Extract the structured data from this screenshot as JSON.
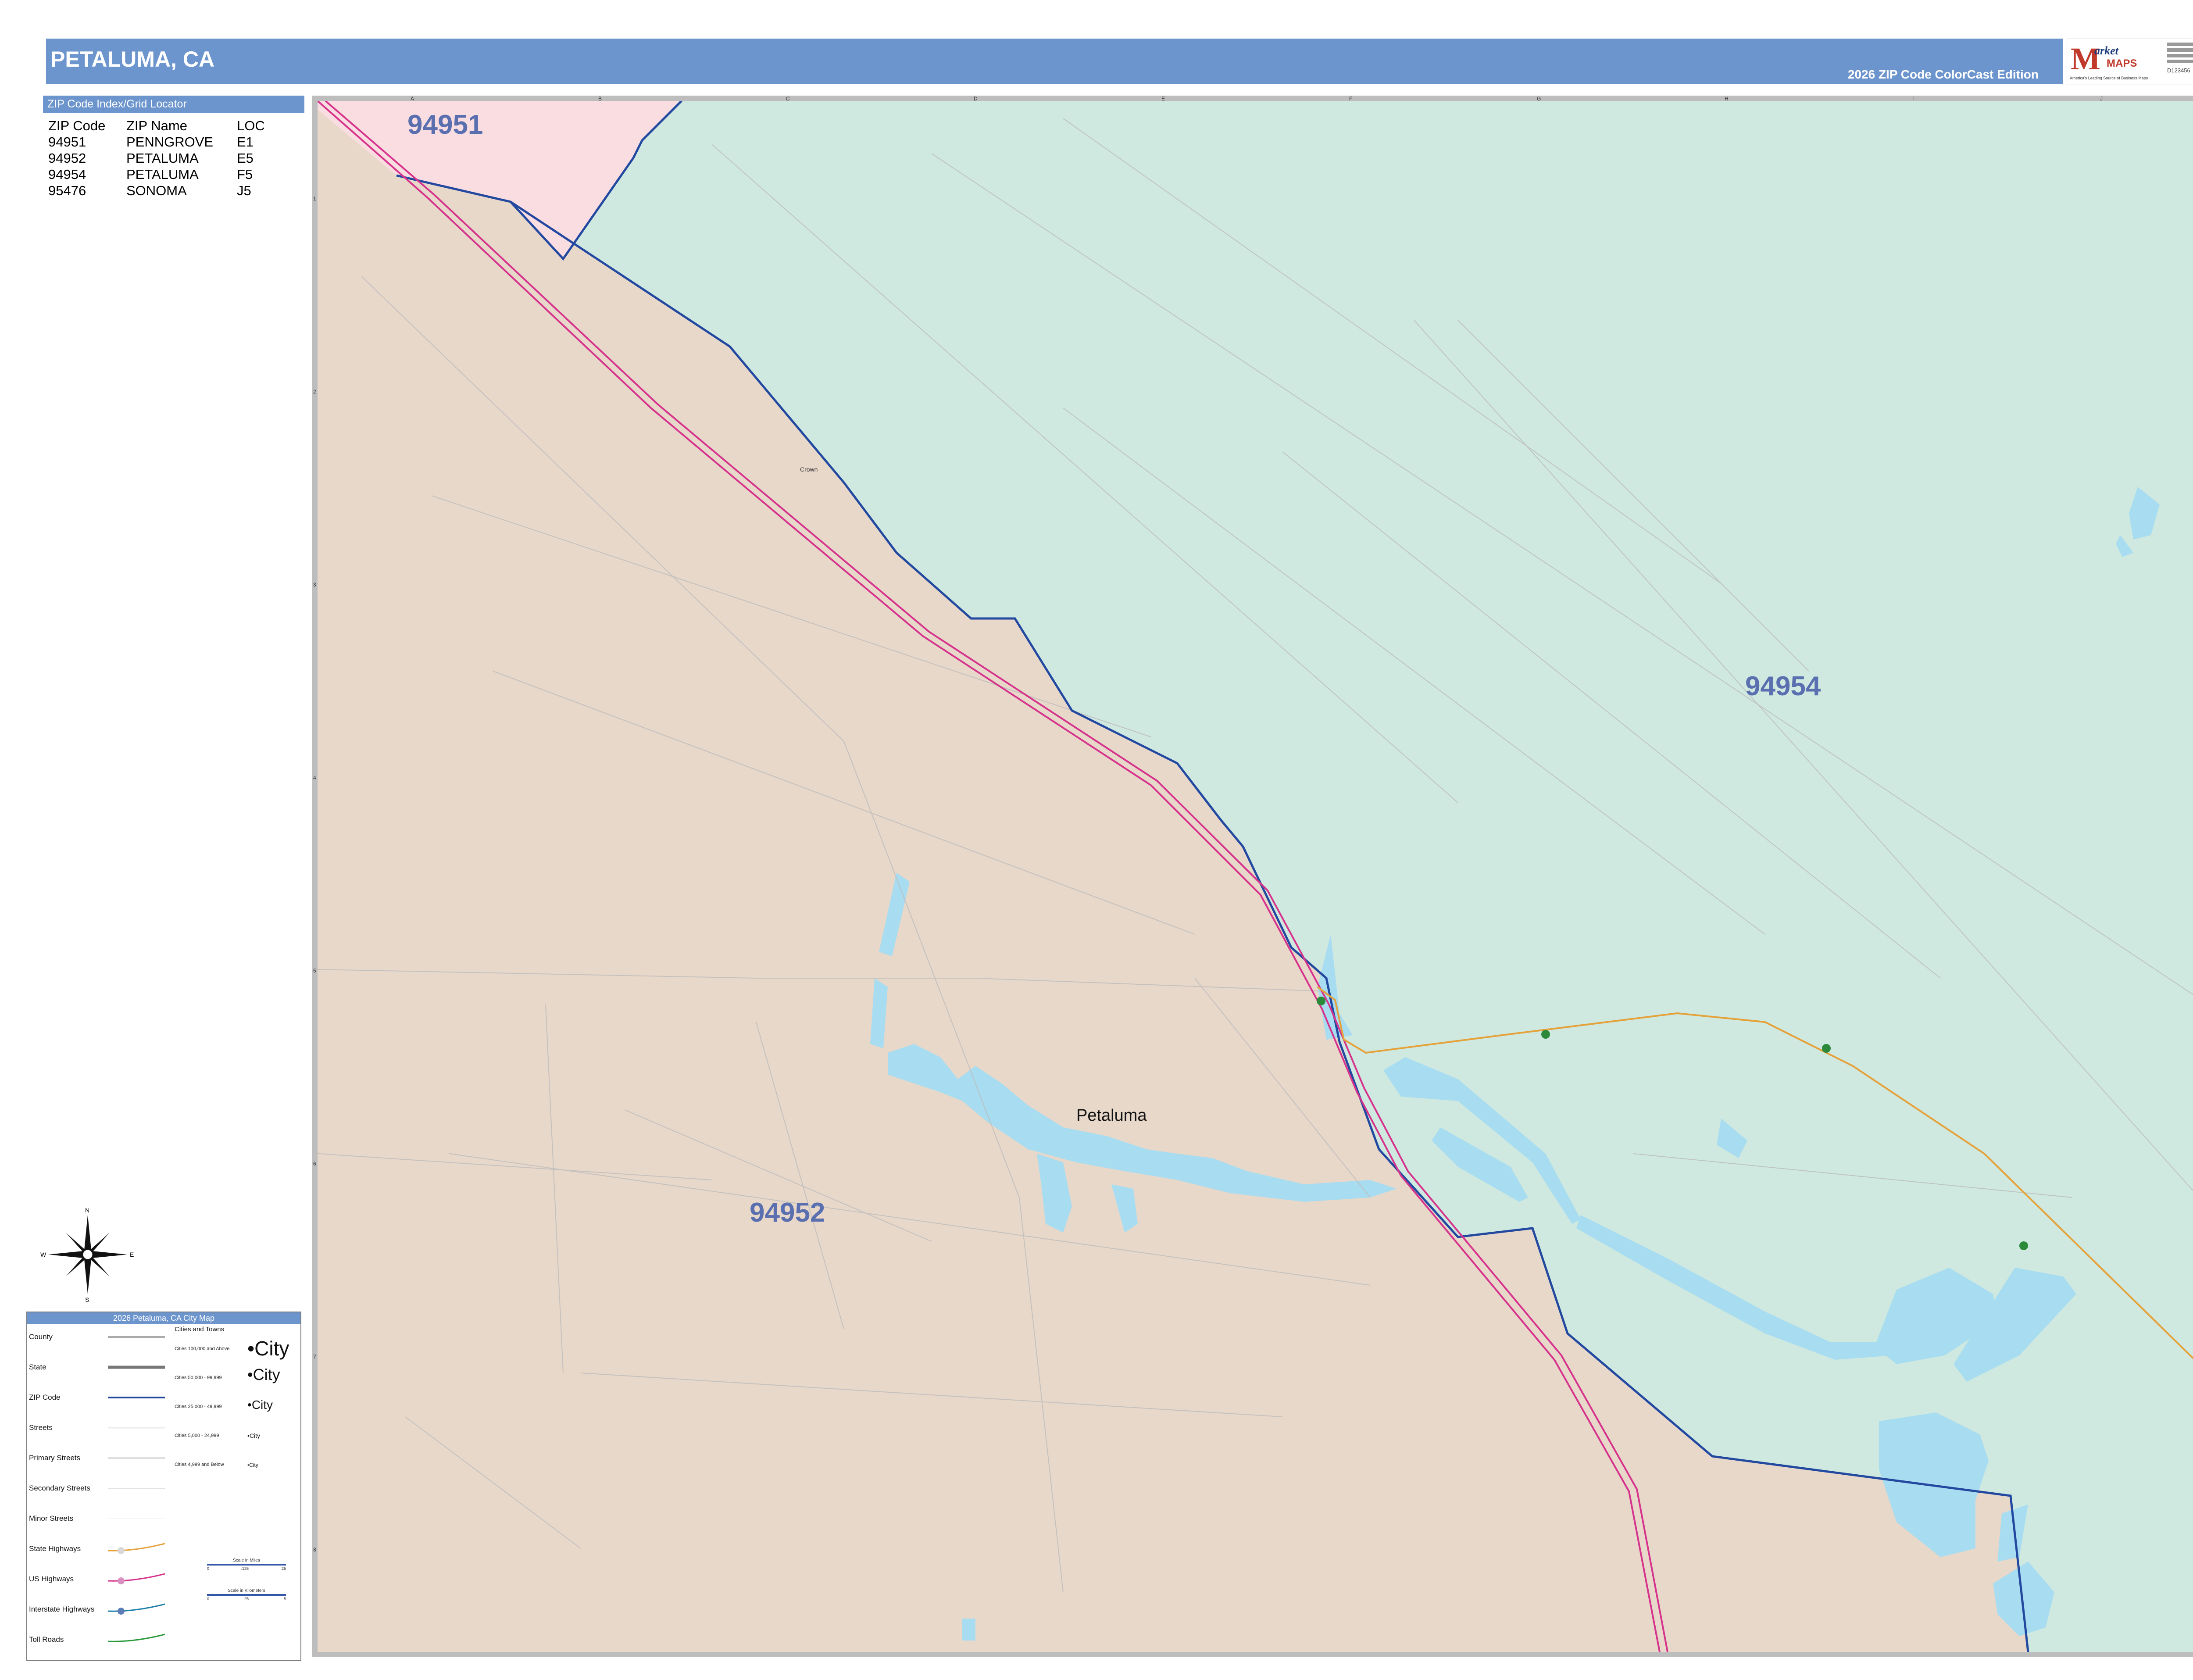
{
  "header": {
    "title": "PETALUMA, CA",
    "edition": "2026 ZIP Code ColorCast Edition"
  },
  "logo": {
    "letter": "M",
    "word1": "arket",
    "word2": "MAPS",
    "tagline": "America's Leading Source of Business Maps",
    "code": "D123456"
  },
  "index": {
    "heading": "ZIP Code Index/Grid Locator",
    "columns": [
      "ZIP Code",
      "ZIP Name",
      "LOC"
    ],
    "rows": [
      [
        "94951",
        "PENNGROVE",
        "E1"
      ],
      [
        "94952",
        "PETALUMA",
        "E5"
      ],
      [
        "94954",
        "PETALUMA",
        "F5"
      ],
      [
        "95476",
        "SONOMA",
        "J5"
      ]
    ]
  },
  "map": {
    "zip_labels": {
      "north": "94951",
      "east": "94954",
      "west": "94952"
    },
    "city_label": "Petaluma",
    "place_label": "Crown",
    "grid_columns": [
      "A",
      "B",
      "C",
      "D",
      "E",
      "F",
      "G",
      "H",
      "I",
      "J"
    ],
    "grid_rows": [
      "1",
      "2",
      "3",
      "4",
      "5",
      "6",
      "7",
      "8"
    ],
    "colors": {
      "zip_94951": "#fadde0",
      "zip_94954": "#cfe9e0",
      "zip_94952": "#e8d8ca",
      "water": "#a8dcf0",
      "zip_boundary": "#2248a0",
      "us_highway": "#d6338c",
      "state_highway": "#e5a23b"
    }
  },
  "compass": {
    "n": "N",
    "s": "S",
    "e": "E",
    "w": "W"
  },
  "legend": {
    "heading": "2026 Petaluma, CA City Map",
    "rows": [
      "County",
      "State",
      "ZIP Code",
      "Streets",
      "Primary Streets",
      "Secondary Streets",
      "Minor Streets",
      "State Highways",
      "US Highways",
      "Interstate Highways",
      "Toll Roads"
    ],
    "cities_heading": "Cities and Towns",
    "cities": [
      {
        "range": "Cities 100,000 and Above",
        "sample": "City"
      },
      {
        "range": "Cities 50,000 - 99,999",
        "sample": "City"
      },
      {
        "range": "Cities 25,000 - 49,999",
        "sample": "City"
      },
      {
        "range": "Cities 5,000 - 24,999",
        "sample": "City"
      },
      {
        "range": "Cities 4,999 and Below",
        "sample": "City"
      }
    ],
    "scale_miles": {
      "label": "Scale in Miles",
      "ticks": [
        "0",
        ".125",
        ".25"
      ]
    },
    "scale_km": {
      "label": "Scale in Kilometers",
      "ticks": [
        "0",
        ".25",
        ".5"
      ]
    }
  }
}
